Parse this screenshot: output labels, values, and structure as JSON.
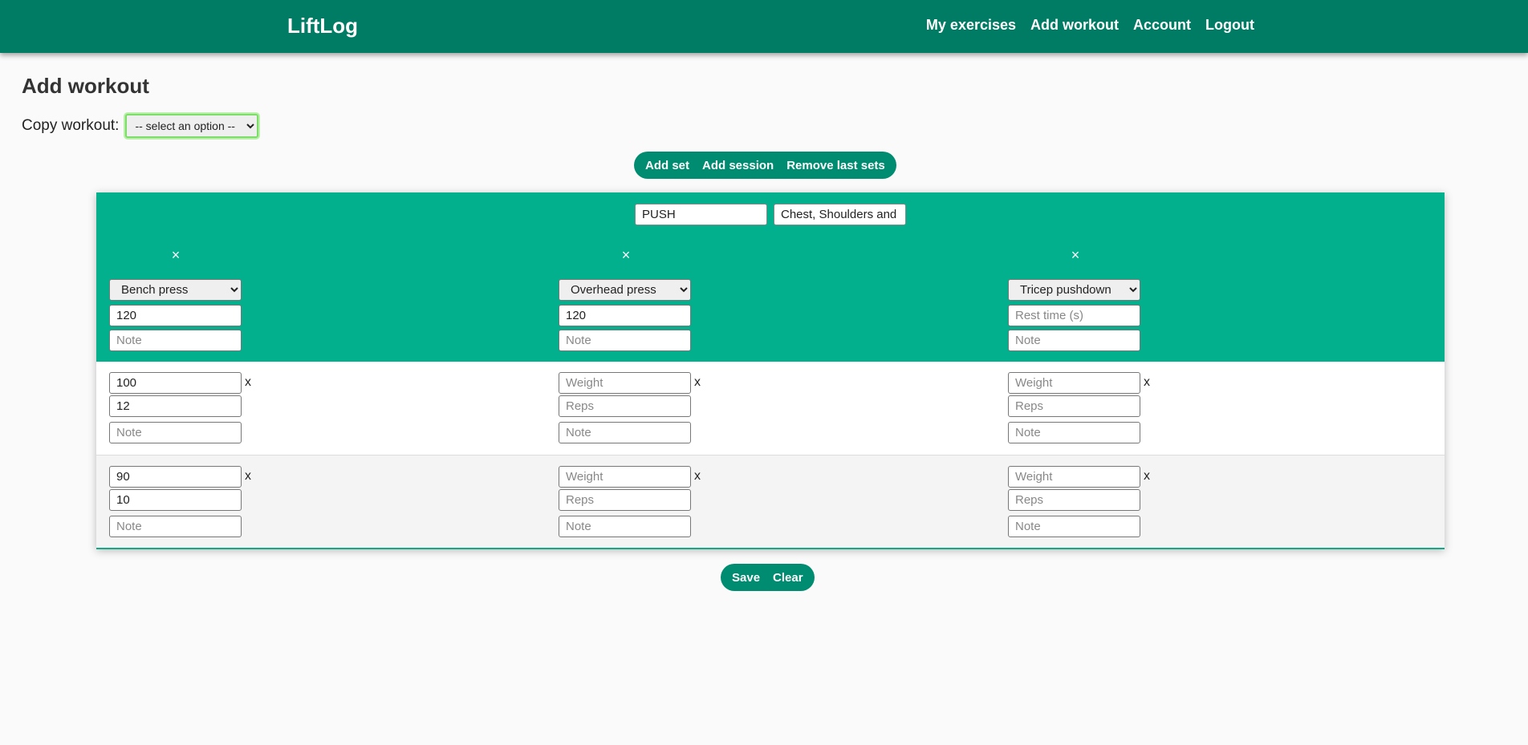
{
  "nav": {
    "brand": "LiftLog",
    "links": [
      "My exercises",
      "Add workout",
      "Account",
      "Logout"
    ]
  },
  "page": {
    "title": "Add workout",
    "copy_label": "Copy workout:",
    "copy_select_value": "-- select an option --"
  },
  "actions": [
    "Add set",
    "Add session",
    "Remove last sets"
  ],
  "session": {
    "name": "PUSH",
    "description": "Chest, Shoulders and Triceps"
  },
  "close_symbol": "×",
  "set_separator": "x",
  "exercises": [
    {
      "name": "Bench press",
      "rest": "120",
      "rest_placeholder": "Rest time (s)",
      "note_placeholder": "Note",
      "sets": [
        {
          "weight": "100",
          "reps": "12",
          "weight_placeholder": "Weight",
          "reps_placeholder": "Reps",
          "note_placeholder": "Note"
        },
        {
          "weight": "90",
          "reps": "10",
          "weight_placeholder": "Weight",
          "reps_placeholder": "Reps",
          "note_placeholder": "Note"
        }
      ]
    },
    {
      "name": "Overhead press",
      "rest": "120",
      "rest_placeholder": "Rest time (s)",
      "note_placeholder": "Note",
      "sets": [
        {
          "weight": "",
          "reps": "",
          "weight_placeholder": "Weight",
          "reps_placeholder": "Reps",
          "note_placeholder": "Note"
        },
        {
          "weight": "",
          "reps": "",
          "weight_placeholder": "Weight",
          "reps_placeholder": "Reps",
          "note_placeholder": "Note"
        }
      ]
    },
    {
      "name": "Tricep pushdown",
      "rest": "",
      "rest_placeholder": "Rest time (s)",
      "note_placeholder": "Note",
      "sets": [
        {
          "weight": "",
          "reps": "",
          "weight_placeholder": "Weight",
          "reps_placeholder": "Reps",
          "note_placeholder": "Note"
        },
        {
          "weight": "",
          "reps": "",
          "weight_placeholder": "Weight",
          "reps_placeholder": "Reps",
          "note_placeholder": "Note"
        }
      ]
    }
  ],
  "footer_actions": [
    "Save",
    "Clear"
  ],
  "colors": {
    "navbar": "#007b64",
    "header": "#02b08d",
    "pill": "#008c70"
  }
}
